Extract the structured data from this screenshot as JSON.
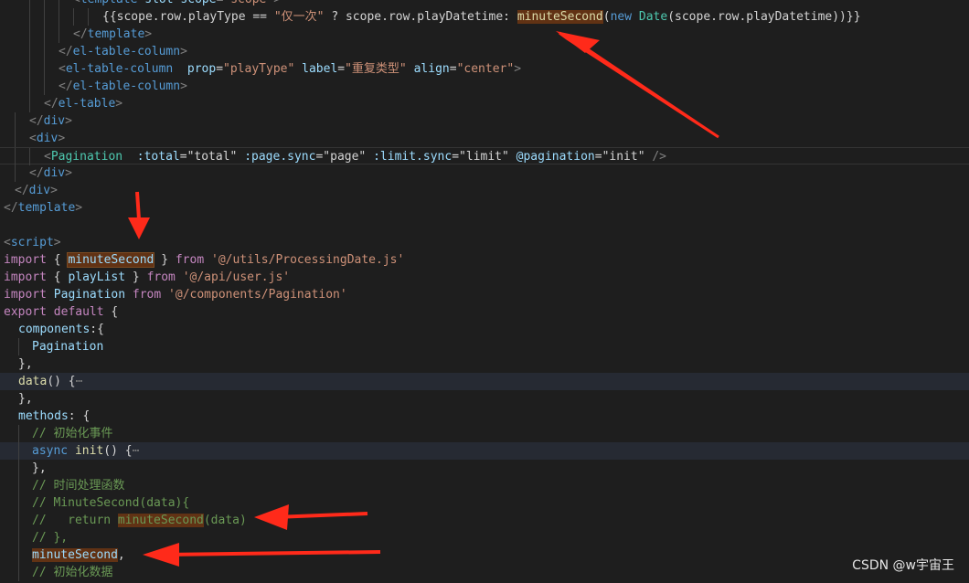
{
  "lines": [
    {
      "indent": 80,
      "guides": [
        32,
        48,
        64
      ],
      "tokens": [
        {
          "t": "<",
          "c": "c-punct"
        },
        {
          "t": "template",
          "c": "c-tag"
        },
        {
          "t": " ",
          "c": "c-plain"
        },
        {
          "t": "slot-scope",
          "c": "c-attr"
        },
        {
          "t": "=",
          "c": "c-plain"
        },
        {
          "t": "\"scope\"",
          "c": "c-str"
        },
        {
          "t": ">",
          "c": "c-punct"
        }
      ]
    },
    {
      "indent": 112,
      "guides": [
        32,
        48,
        64,
        80,
        96
      ],
      "tokens": [
        {
          "t": "{{scope.row.playType == ",
          "c": "c-plain"
        },
        {
          "t": "\"仅一次\"",
          "c": "c-str"
        },
        {
          "t": " ? scope.row.playDatetime: ",
          "c": "c-plain"
        },
        {
          "t": "minuteSecond",
          "c": "c-fn",
          "hl": true
        },
        {
          "t": "(",
          "c": "c-plain"
        },
        {
          "t": "new",
          "c": "c-kwb"
        },
        {
          "t": " ",
          "c": "c-plain"
        },
        {
          "t": "Date",
          "c": "c-comp"
        },
        {
          "t": "(scope.row.playDatetime))}}",
          "c": "c-plain"
        }
      ]
    },
    {
      "indent": 80,
      "guides": [
        32,
        48,
        64
      ],
      "tokens": [
        {
          "t": "</",
          "c": "c-punct"
        },
        {
          "t": "template",
          "c": "c-tag"
        },
        {
          "t": ">",
          "c": "c-punct"
        }
      ]
    },
    {
      "indent": 64,
      "guides": [
        32,
        48
      ],
      "tokens": [
        {
          "t": "</",
          "c": "c-punct"
        },
        {
          "t": "el-table-column",
          "c": "c-tag"
        },
        {
          "t": ">",
          "c": "c-punct"
        }
      ]
    },
    {
      "indent": 64,
      "guides": [
        32,
        48
      ],
      "tokens": [
        {
          "t": "<",
          "c": "c-punct"
        },
        {
          "t": "el-table-column",
          "c": "c-tag"
        },
        {
          "t": "  ",
          "c": "c-plain"
        },
        {
          "t": "prop",
          "c": "c-attr"
        },
        {
          "t": "=",
          "c": "c-plain"
        },
        {
          "t": "\"playType\"",
          "c": "c-str"
        },
        {
          "t": " ",
          "c": "c-plain"
        },
        {
          "t": "label",
          "c": "c-attr"
        },
        {
          "t": "=",
          "c": "c-plain"
        },
        {
          "t": "\"重复类型\"",
          "c": "c-str"
        },
        {
          "t": " ",
          "c": "c-plain"
        },
        {
          "t": "align",
          "c": "c-attr"
        },
        {
          "t": "=",
          "c": "c-plain"
        },
        {
          "t": "\"center\"",
          "c": "c-str"
        },
        {
          "t": ">",
          "c": "c-punct"
        }
      ]
    },
    {
      "indent": 64,
      "guides": [
        32,
        48
      ],
      "tokens": [
        {
          "t": "</",
          "c": "c-punct"
        },
        {
          "t": "el-table-column",
          "c": "c-tag"
        },
        {
          "t": ">",
          "c": "c-punct"
        }
      ]
    },
    {
      "indent": 48,
      "guides": [
        32
      ],
      "tokens": [
        {
          "t": "</",
          "c": "c-punct"
        },
        {
          "t": "el-table",
          "c": "c-tag"
        },
        {
          "t": ">",
          "c": "c-punct"
        }
      ]
    },
    {
      "indent": 32,
      "guides": [
        16
      ],
      "tokens": [
        {
          "t": "</",
          "c": "c-punct"
        },
        {
          "t": "div",
          "c": "c-tag"
        },
        {
          "t": ">",
          "c": "c-punct"
        }
      ]
    },
    {
      "indent": 32,
      "guides": [
        16
      ],
      "tokens": [
        {
          "t": "<",
          "c": "c-punct"
        },
        {
          "t": "div",
          "c": "c-tag"
        },
        {
          "t": ">",
          "c": "c-punct"
        }
      ]
    },
    {
      "indent": 48,
      "guides": [
        16,
        32
      ],
      "boxed": true,
      "tokens": [
        {
          "t": "<",
          "c": "c-punct"
        },
        {
          "t": "Pagination",
          "c": "c-comp"
        },
        {
          "t": "  ",
          "c": "c-plain"
        },
        {
          "t": ":total",
          "c": "c-attr"
        },
        {
          "t": "=",
          "c": "c-plain"
        },
        {
          "t": "\"total\"",
          "c": "c-plain"
        },
        {
          "t": " ",
          "c": "c-plain"
        },
        {
          "t": ":page.sync",
          "c": "c-attr"
        },
        {
          "t": "=",
          "c": "c-plain"
        },
        {
          "t": "\"page\"",
          "c": "c-plain"
        },
        {
          "t": " ",
          "c": "c-plain"
        },
        {
          "t": ":limit.sync",
          "c": "c-attr"
        },
        {
          "t": "=",
          "c": "c-plain"
        },
        {
          "t": "\"limit\"",
          "c": "c-plain"
        },
        {
          "t": " ",
          "c": "c-plain"
        },
        {
          "t": "@pagination",
          "c": "c-attr"
        },
        {
          "t": "=",
          "c": "c-plain"
        },
        {
          "t": "\"init\"",
          "c": "c-plain"
        },
        {
          "t": " />",
          "c": "c-punct"
        }
      ]
    },
    {
      "indent": 32,
      "guides": [
        16
      ],
      "tokens": [
        {
          "t": "</",
          "c": "c-punct"
        },
        {
          "t": "div",
          "c": "c-tag"
        },
        {
          "t": ">",
          "c": "c-punct"
        }
      ]
    },
    {
      "indent": 16,
      "guides": [],
      "tokens": [
        {
          "t": "</",
          "c": "c-punct"
        },
        {
          "t": "div",
          "c": "c-tag"
        },
        {
          "t": ">",
          "c": "c-punct"
        }
      ]
    },
    {
      "indent": 4,
      "guides": [],
      "tokens": [
        {
          "t": "</",
          "c": "c-punct"
        },
        {
          "t": "template",
          "c": "c-tag"
        },
        {
          "t": ">",
          "c": "c-punct"
        }
      ]
    },
    {
      "indent": 4,
      "guides": [],
      "tokens": []
    },
    {
      "indent": 4,
      "guides": [],
      "tokens": [
        {
          "t": "<",
          "c": "c-punct"
        },
        {
          "t": "script",
          "c": "c-tag"
        },
        {
          "t": ">",
          "c": "c-punct"
        }
      ]
    },
    {
      "indent": 4,
      "guides": [],
      "tokens": [
        {
          "t": "import",
          "c": "c-kw"
        },
        {
          "t": " { ",
          "c": "c-plain"
        },
        {
          "t": "minuteSecond",
          "c": "c-var",
          "hl": true,
          "border": true
        },
        {
          "t": " } ",
          "c": "c-plain"
        },
        {
          "t": "from",
          "c": "c-kw"
        },
        {
          "t": " ",
          "c": "c-plain"
        },
        {
          "t": "'@/utils/ProcessingDate.js'",
          "c": "c-str"
        }
      ]
    },
    {
      "indent": 4,
      "guides": [],
      "tokens": [
        {
          "t": "import",
          "c": "c-kw"
        },
        {
          "t": " { ",
          "c": "c-plain"
        },
        {
          "t": "playList",
          "c": "c-var"
        },
        {
          "t": " } ",
          "c": "c-plain"
        },
        {
          "t": "from",
          "c": "c-kw"
        },
        {
          "t": " ",
          "c": "c-plain"
        },
        {
          "t": "'@/api/user.js'",
          "c": "c-str"
        }
      ]
    },
    {
      "indent": 4,
      "guides": [],
      "tokens": [
        {
          "t": "import",
          "c": "c-kw"
        },
        {
          "t": " ",
          "c": "c-plain"
        },
        {
          "t": "Pagination",
          "c": "c-var"
        },
        {
          "t": " ",
          "c": "c-plain"
        },
        {
          "t": "from",
          "c": "c-kw"
        },
        {
          "t": " ",
          "c": "c-plain"
        },
        {
          "t": "'@/components/Pagination'",
          "c": "c-str"
        }
      ]
    },
    {
      "indent": 4,
      "guides": [],
      "tokens": [
        {
          "t": "export",
          "c": "c-kw"
        },
        {
          "t": " ",
          "c": "c-plain"
        },
        {
          "t": "default",
          "c": "c-kw"
        },
        {
          "t": " {",
          "c": "c-plain"
        }
      ]
    },
    {
      "indent": 20,
      "guides": [],
      "tokens": [
        {
          "t": "components",
          "c": "c-var"
        },
        {
          "t": ":{",
          "c": "c-plain"
        }
      ]
    },
    {
      "indent": 35,
      "guides": [
        20
      ],
      "tokens": [
        {
          "t": "Pagination",
          "c": "c-var"
        }
      ]
    },
    {
      "indent": 20,
      "guides": [],
      "tokens": [
        {
          "t": "},",
          "c": "c-plain"
        }
      ]
    },
    {
      "indent": 20,
      "guides": [],
      "highlight": true,
      "tokens": [
        {
          "t": "data",
          "c": "c-fn"
        },
        {
          "t": "() {",
          "c": "c-plain"
        },
        {
          "t": "⋯",
          "c": "c-fold"
        }
      ]
    },
    {
      "indent": 20,
      "guides": [],
      "tokens": [
        {
          "t": "},",
          "c": "c-plain"
        }
      ]
    },
    {
      "indent": 20,
      "guides": [],
      "tokens": [
        {
          "t": "methods",
          "c": "c-var"
        },
        {
          "t": ": {",
          "c": "c-plain"
        }
      ]
    },
    {
      "indent": 35,
      "guides": [
        20
      ],
      "tokens": [
        {
          "t": "// 初始化事件",
          "c": "c-cmt"
        }
      ]
    },
    {
      "indent": 35,
      "guides": [
        20
      ],
      "highlight": true,
      "tokens": [
        {
          "t": "async",
          "c": "c-kwb"
        },
        {
          "t": " ",
          "c": "c-plain"
        },
        {
          "t": "init",
          "c": "c-fn"
        },
        {
          "t": "() {",
          "c": "c-plain"
        },
        {
          "t": "⋯",
          "c": "c-fold"
        }
      ]
    },
    {
      "indent": 35,
      "guides": [
        20
      ],
      "tokens": [
        {
          "t": "},",
          "c": "c-plain"
        }
      ]
    },
    {
      "indent": 35,
      "guides": [
        20
      ],
      "tokens": [
        {
          "t": "// 时间处理函数",
          "c": "c-cmt"
        }
      ]
    },
    {
      "indent": 35,
      "guides": [
        20
      ],
      "tokens": [
        {
          "t": "// MinuteSecond(data){",
          "c": "c-cmt"
        }
      ]
    },
    {
      "indent": 35,
      "guides": [
        20
      ],
      "tokens": [
        {
          "t": "//   return ",
          "c": "c-cmt"
        },
        {
          "t": "minuteSecond",
          "c": "c-cmt",
          "hl": true
        },
        {
          "t": "(data)",
          "c": "c-cmt"
        }
      ]
    },
    {
      "indent": 35,
      "guides": [
        20
      ],
      "tokens": [
        {
          "t": "// },",
          "c": "c-cmt"
        }
      ]
    },
    {
      "indent": 35,
      "guides": [
        20
      ],
      "tokens": [
        {
          "t": "minuteSecond",
          "c": "c-var",
          "hl": true
        },
        {
          "t": ",",
          "c": "c-plain"
        }
      ]
    },
    {
      "indent": 35,
      "guides": [
        20
      ],
      "tokens": [
        {
          "t": "// 初始化数据",
          "c": "c-cmt"
        }
      ]
    }
  ],
  "annotations": {
    "color": "#ff2a1a",
    "arrows_count": 5
  },
  "watermark": "CSDN @w宇宙王"
}
